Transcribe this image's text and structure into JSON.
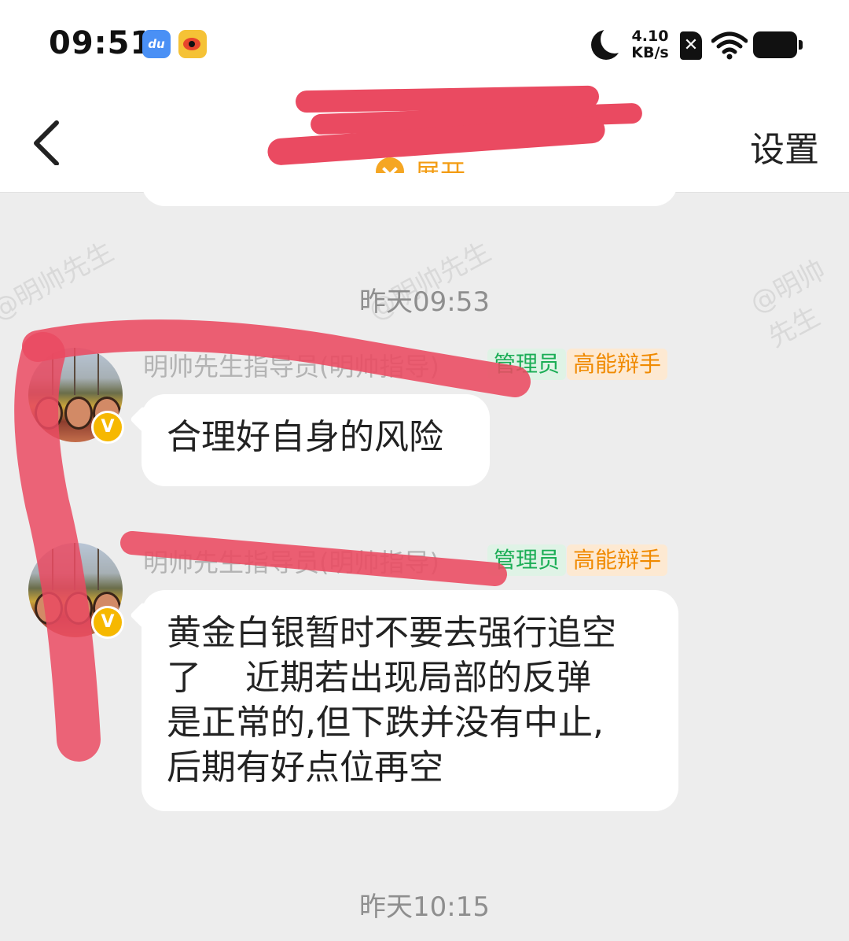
{
  "status_bar": {
    "time": "09:51",
    "apps": [
      "baidu-icon",
      "weibo-icon"
    ],
    "baidu_label": "du",
    "net_speed_value": "4.10",
    "net_speed_unit": "KB/s",
    "sim_symbol": "✕",
    "icons": [
      "moon-icon",
      "sim-off-icon",
      "wifi-icon",
      "battery-icon"
    ]
  },
  "header": {
    "group_name": "",
    "expand_label": "展开",
    "settings_label": "设置"
  },
  "watermark": "@明帅先生",
  "messages": [
    {
      "timestamp": "昨天09:53",
      "sender": "明帅先生指导员(明帅指导)",
      "tags": [
        "管理员",
        "高能辩手"
      ],
      "verified_badge": "V",
      "text": "合理好自身的风险"
    },
    {
      "sender": "明帅先生指导员(明帅指导)",
      "tags": [
        "管理员",
        "高能辩手"
      ],
      "verified_badge": "V",
      "text": "黄金白银暂时不要去强行追空\n了    近期若出现局部的反弹\n是正常的,但下跌并没有中止,\n后期有好点位再空"
    }
  ],
  "trailing_timestamp": "昨天10:15",
  "colors": {
    "background": "#ededed",
    "accent_orange": "#f39c12",
    "admin_green": "#1aad55",
    "debater_orange": "#f08a00",
    "redaction_red": "#ea4a61"
  }
}
